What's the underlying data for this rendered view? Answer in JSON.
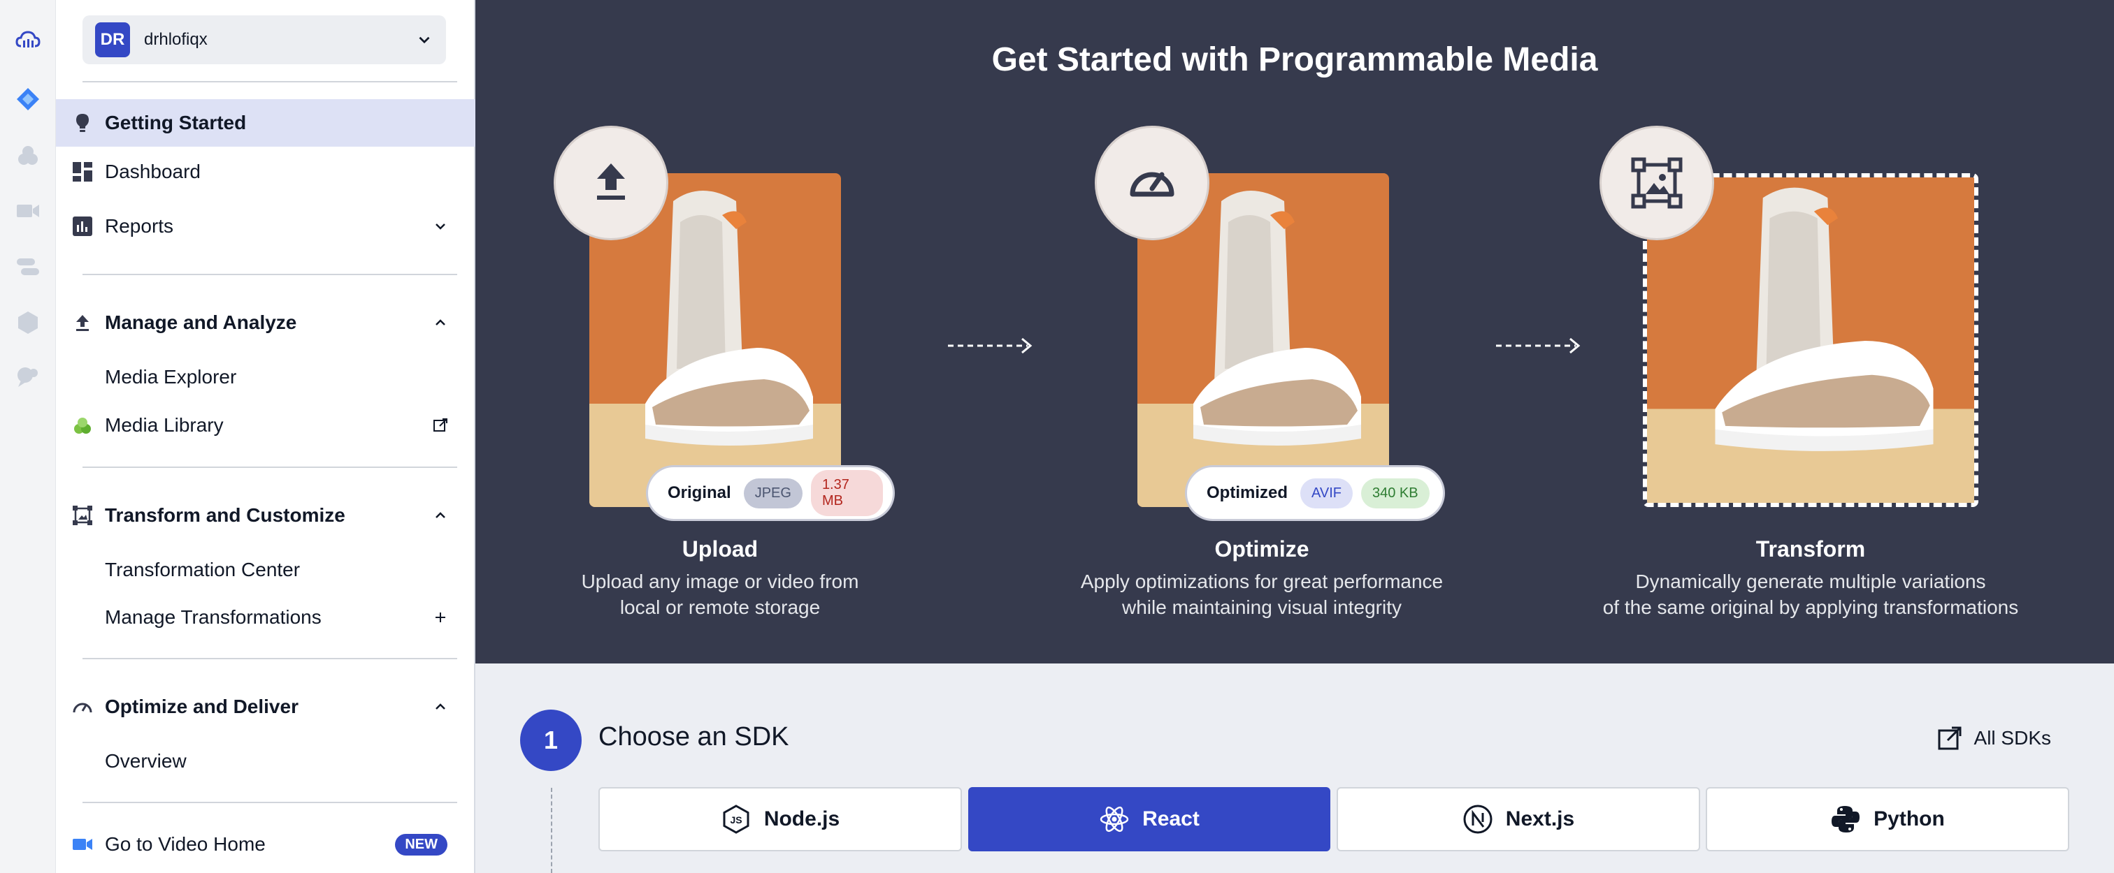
{
  "account": {
    "initials": "DR",
    "name": "drhlofiqx"
  },
  "sidebar": {
    "getting_started": "Getting Started",
    "dashboard": "Dashboard",
    "reports": "Reports",
    "manage_analyze": "Manage and Analyze",
    "media_explorer": "Media Explorer",
    "media_library": "Media Library",
    "transform_customize": "Transform and Customize",
    "transformation_center": "Transformation Center",
    "manage_transformations": "Manage Transformations",
    "optimize_deliver": "Optimize and Deliver",
    "overview": "Overview",
    "video_home": "Go to Video Home",
    "new_badge": "NEW"
  },
  "hero": {
    "title": "Get Started with Programmable Media",
    "upload": {
      "title": "Upload",
      "desc1": "Upload any image or video from",
      "desc2": "local or remote storage",
      "pill_label": "Original",
      "format": "JPEG",
      "size": "1.37 MB"
    },
    "optimize": {
      "title": "Optimize",
      "desc1": "Apply optimizations for great performance",
      "desc2": "while maintaining visual integrity",
      "pill_label": "Optimized",
      "format": "AVIF",
      "size": "340 KB"
    },
    "transform": {
      "title": "Transform",
      "desc1": "Dynamically generate multiple variations",
      "desc2": "of the same original by applying transformations"
    }
  },
  "sdk": {
    "step": "1",
    "heading": "Choose an SDK",
    "all_sdks": "All SDKs",
    "options": [
      "Node.js",
      "React",
      "Next.js",
      "Python"
    ],
    "selected": "React"
  },
  "colors": {
    "accent": "#3448c5",
    "hero_bg": "#363a4d",
    "active_nav": "#dde1f5"
  },
  "icons": [
    "cloudinary-logo-icon",
    "programmable-media-icon",
    "assets-icon",
    "video-icon",
    "connect-icon",
    "hexagon-icon",
    "chat-icon",
    "lightbulb-icon",
    "dashboard-icon",
    "reports-icon",
    "upload-icon",
    "media-library-icon",
    "transform-icon",
    "gauge-icon",
    "video-camera-icon",
    "external-link-icon",
    "plus-icon",
    "chevron-down-icon",
    "chevron-up-icon",
    "nodejs-icon",
    "react-icon",
    "nextjs-icon",
    "python-icon"
  ]
}
